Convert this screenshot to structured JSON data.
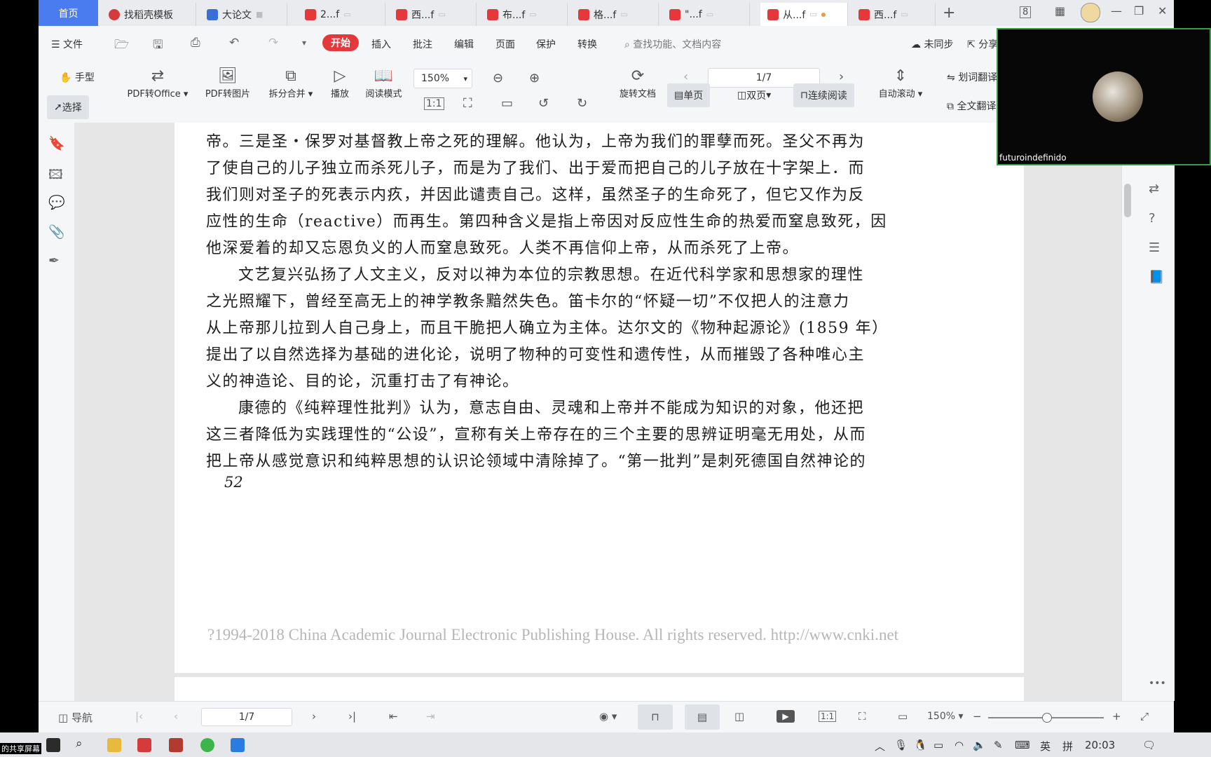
{
  "tabs": [
    {
      "label": "首页"
    },
    {
      "label": "找稻壳模板"
    },
    {
      "label": "大论文"
    },
    {
      "label": "2...f"
    },
    {
      "label": "西...f"
    },
    {
      "label": "布...f"
    },
    {
      "label": "格...f"
    },
    {
      "label": "\"...f"
    },
    {
      "label": "从...f"
    },
    {
      "label": "西...f"
    }
  ],
  "window": {
    "badge": "8"
  },
  "menu": {
    "file": "文件",
    "items": [
      "开始",
      "插入",
      "批注",
      "编辑",
      "页面",
      "保护",
      "转换"
    ],
    "search_placeholder": "查找功能、文档内容",
    "sync": "未同步",
    "share": "分享"
  },
  "toolbar": {
    "hand": "手型",
    "select": "选择",
    "pdf_to_office": "PDF转Office",
    "pdf_to_image": "PDF转图片",
    "split_merge": "拆分合并",
    "play": "播放",
    "read_mode": "阅读模式",
    "zoom": "150%",
    "rotate_doc": "旋转文档",
    "page_indicator": "1/7",
    "single_page": "单页",
    "double_page": "双页",
    "continuous": "连续阅读",
    "auto_scroll": "自动滚动",
    "word_translate": "划词翻译",
    "full_translate": "全文翻译"
  },
  "document": {
    "lines": [
      "帝。三是圣・保罗对基督教上帝之死的理解。他认为，上帝为我们的罪孽而死。圣父不再为",
      "了使自己的儿子独立而杀死儿子，而是为了我们、出于爱而把自己的儿子放在十字架上．而",
      "我们则对圣子的死表示内疚，并因此谴责自己。这样，虽然圣子的生命死了，但它又作为反",
      "应性的生命（reactive）而再生。第四种含义是指上帝因对反应性生命的热爱而窒息致死，因",
      "他深爱着的却又忘恩负义的人而窒息致死。人类不再信仰上帝，从而杀死了上帝。",
      "文艺复兴弘扬了人文主义，反对以神为本位的宗教思想。在近代科学家和思想家的理性",
      "之光照耀下，曾经至高无上的神学教条黯然失色。笛卡尔的“怀疑一切”不仅把人的注意力",
      "从上帝那儿拉到人自己身上，而且干脆把人确立为主体。达尔文的《物种起源论》(1859 年）",
      "提出了以自然选择为基础的进化论，说明了物种的可变性和遗传性，从而摧毁了各种唯心主",
      "义的神造论、目的论，沉重打击了有神论。",
      "康德的《纯粹理性批判》认为，意志自由、灵魂和上帝并不能成为知识的对象，他还把",
      "这三者降低为实践理性的“公设”，宣称有关上帝存在的三个主要的思辨证明毫无用处，从而",
      "把上帝从感觉意识和纯粹思想的认识论领域中清除掉了。“第一批判”是刺死德国自然神论的"
    ],
    "page_number": "52",
    "footer": "?1994-2018 China Academic Journal Electronic Publishing House. All rights reserved.    http://www.cnki.net"
  },
  "status": {
    "nav": "导航",
    "page": "1/7",
    "zoom": "150%"
  },
  "video": {
    "name": "futuroindefinido"
  },
  "taskbar": {
    "ime_lang": "英",
    "ime_mode": "拼",
    "clock": "20:03",
    "share_label": "的共享屏幕"
  },
  "colors": {
    "accent": "#4a7cf0",
    "brand_red": "#e5383b",
    "video_border": "#3a9a4a"
  }
}
